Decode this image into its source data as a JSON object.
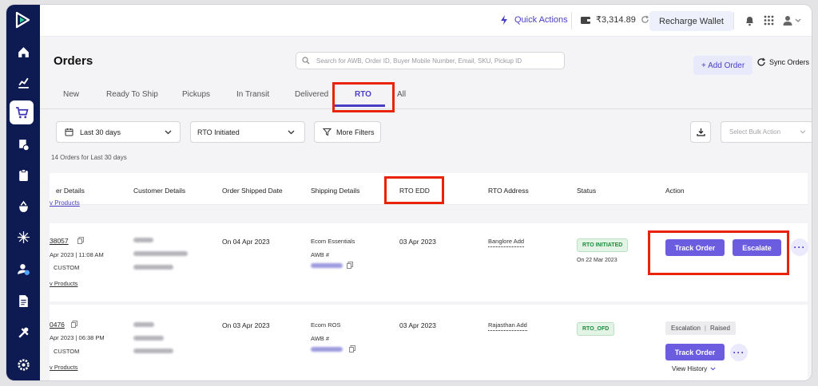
{
  "topbar": {
    "quick_actions": "Quick Actions",
    "wallet_balance": "₹3,314.89",
    "recharge_label": "Recharge Wallet"
  },
  "page": {
    "title": "Orders",
    "search_placeholder": "Search for AWB, Order ID, Buyer Mobile Number, Email, SKU, Pickup ID",
    "add_order": "+ Add Order",
    "sync_orders": "Sync Orders"
  },
  "tabs": [
    "New",
    "Ready To Ship",
    "Pickups",
    "In Transit",
    "Delivered",
    "RTO",
    "All"
  ],
  "filters": {
    "date_range": "Last 30 days",
    "status": "RTO Initiated",
    "more_filters": "More Filters",
    "bulk_action": "Select Bulk Action"
  },
  "order_count": "14 Orders for Last 30 days",
  "table": {
    "headers": [
      "er Details",
      "Customer Details",
      "Order Shipped Date",
      "Shipping Details",
      "RTO EDD",
      "RTO Address",
      "Status",
      "Action"
    ],
    "cut_link": "v Products",
    "rows": [
      {
        "order_id": "38057",
        "order_date": "Apr 2023 | 11:08 AM",
        "order_type": "CUSTOM",
        "view_products": "v Products",
        "shipped_date": "On 04 Apr 2023",
        "courier": "Ecom Essentials",
        "awb_label": "AWB #",
        "rto_edd": "03 Apr 2023",
        "rto_address": "Banglore Add",
        "status": "RTO INITIATED",
        "status_date": "On 22 Mar 2023",
        "action_primary": "Track Order",
        "action_secondary": "Escalate"
      },
      {
        "order_id": "0476",
        "order_date": "Apr 2023 | 06:38 PM",
        "order_type": "CUSTOM",
        "view_products": "v Products",
        "shipped_date": "On 03 Apr 2023",
        "courier": "Ecom ROS",
        "awb_label": "AWB #",
        "rto_edd": "03 Apr 2023",
        "rto_address": "Rajasthan Add",
        "status": "RTO_OFD",
        "escalation_label": "Escalation",
        "escalation_state": "Raised",
        "action_primary": "Track Order",
        "view_history": "View History"
      }
    ]
  },
  "colors": {
    "sidebar": "#0e1a52",
    "accent": "#6b5ce0",
    "highlight": "#e8230a",
    "status_green": "#1d8a3a"
  },
  "icons": {
    "sidebar": [
      "home-icon",
      "chart-icon",
      "cart-icon",
      "returns-icon",
      "clipboard-icon",
      "bag-icon",
      "hub-icon",
      "user-check-icon",
      "document-icon",
      "tools-icon",
      "settings-icon"
    ]
  }
}
